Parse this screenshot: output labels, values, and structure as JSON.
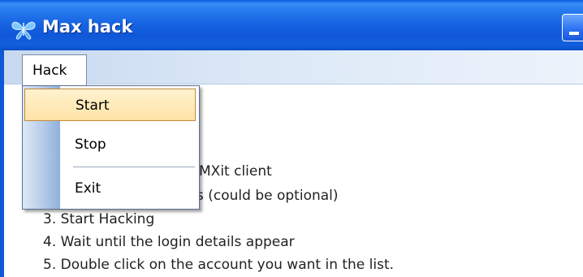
{
  "window": {
    "title": "Max hack",
    "icon": "butterfly-app-icon",
    "minimize_icon": "minimize-icon"
  },
  "menubar": {
    "items": [
      {
        "label": "Hack"
      }
    ]
  },
  "dropdown": {
    "items": [
      {
        "label": "Start",
        "highlighted": true
      },
      {
        "label": "Stop"
      },
      {
        "separator": true
      },
      {
        "label": "Exit"
      }
    ]
  },
  "content": {
    "lines": [
      "MXit client",
      "s (could be optional)",
      "3. Start Hacking",
      "4. Wait until the login details appear",
      "5. Double click on the account you want in the list."
    ]
  },
  "colors": {
    "titlebar": "#1865e3",
    "highlight": "#ffe3a6",
    "highlight_border": "#c28a3a",
    "menubar": "#dae7f6"
  }
}
